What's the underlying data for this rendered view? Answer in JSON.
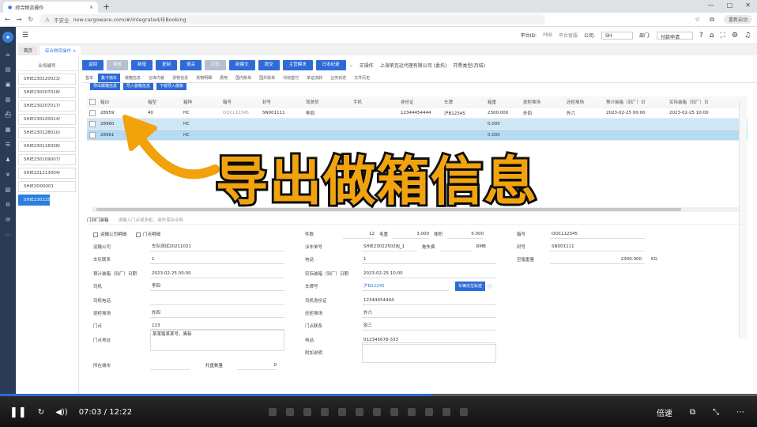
{
  "browser": {
    "tab_title": "综合物流操作",
    "not_secure": "不安全",
    "url": "new.cargoware.com/#/Integrated/IEBooking",
    "restart": "重新启动"
  },
  "topbar": {
    "platform_label": "平台ID:",
    "platform_value": "PBB",
    "platform_name": "平台客服",
    "company_label": "公司:",
    "company_value": "SH",
    "dept_label": "部门:",
    "dept_value": "付款申请"
  },
  "page_tabs": [
    {
      "label": "首页"
    },
    {
      "label": "综合物流操作 ×"
    }
  ],
  "booking_list": {
    "header": "业务编号",
    "items": [
      "SHIE230220023/",
      "SHIE230207018/",
      "SHIE230207017/",
      "SHIE230220014/",
      "SHIE230128010/",
      "SHIE230116008/",
      "SHIE230109007/",
      "SHIE221213004/",
      "SHIE2D00001",
      "SHIE230225028/"
    ],
    "selected_index": 9
  },
  "toolbar": {
    "buttons": [
      "返回",
      "审核",
      "新增",
      "复制",
      "退关",
      "打印",
      "新建文",
      "提交",
      "主营模块",
      "日本纪录"
    ],
    "status_text": "正操作",
    "company_text": "上海荣克运代理有限公司 (委托)",
    "type_text": "开票类型(月结)"
  },
  "subtabs": [
    "基本",
    "集卡拖车",
    "装箱信息",
    "仓库内装",
    "货物信息",
    "货物明细",
    "费用",
    "国内账单",
    "国外账单",
    "代收垫付",
    "单证流转",
    "业务状态",
    "文件历史"
  ],
  "action_buttons": [
    "导出做箱信息",
    "导入装箱信息",
    "下载导入模板"
  ],
  "grid": {
    "columns": [
      "箱ID",
      "箱型",
      "箱种",
      "箱号",
      "封号",
      "驾驶员",
      "手机",
      "身份证",
      "车牌",
      "箱重",
      "提柜堆场",
      "还柜堆场",
      "预计装箱（到厂）日",
      "实际装箱（到厂）日"
    ],
    "rows": [
      [
        "28959",
        "40",
        "HC",
        "OOCL12345",
        "SN001111",
        "李四",
        "",
        "12344454444",
        "沪B12345",
        "2300.000",
        "外四",
        "外六",
        "2023-02-25 00:00",
        "2023-02-25 10:00"
      ],
      [
        "28960",
        "",
        "HC",
        "",
        "",
        "",
        "",
        "",
        "",
        "0.000",
        "",
        "",
        "",
        ""
      ],
      [
        "28961",
        "",
        "HC",
        "",
        "",
        "",
        "",
        "",
        "",
        "0.000",
        "",
        "",
        "",
        ""
      ]
    ]
  },
  "panel": {
    "title": "门到门装箱",
    "hint": "请输入门点或多柜，请先保存业务",
    "checks": [
      "运输公司明细",
      "门点明细"
    ]
  },
  "form": {
    "transport_company_label": "运输公司",
    "transport_company": "车队测试20211021",
    "fleet_contact_label": "车队联系",
    "fleet_contact": "1",
    "est_label": "预计装箱（到厂）日期",
    "est": "2023-02-25 00:00",
    "driver_label": "司机",
    "driver": "李四",
    "driver_phone_label": "司机电话",
    "pickup_yard_label": "提柜堆场",
    "pickup_yard": "外四",
    "door_label": "门点",
    "door": "123",
    "door_addr_label": "门点地址",
    "door_addr": "某某路某某号，奥新",
    "city_label": "所在城市",
    "pallets_label": "托盘数量",
    "pallets": "0",
    "pieces_label": "件数",
    "pieces": "12",
    "gross_label": "毛重",
    "gross": "3.000",
    "volume_label": "体积",
    "volume": "5.000",
    "dispatch_label": "派车单号",
    "dispatch": "SHIE230225028J_1",
    "freight_label": "拖车费",
    "freight_unit": "RMB",
    "phone_label": "电话",
    "phone": "1",
    "actual_label": "实际装箱（到厂）日期",
    "actual": "2023-02-25 10:00",
    "plate_label": "车牌号",
    "plate": "沪B12345",
    "geo_button": "车辆定位轨迹",
    "id_label": "司机身份证",
    "id": "12344454444",
    "return_yard_label": "还柜堆场",
    "return_yard": "外六",
    "contact_label": "门点联系",
    "contact": "张三",
    "tel_label": "电话",
    "tel": "012345678-333",
    "remark_label": "附加说明",
    "box_no_label": "箱号",
    "box_no": "OOCL12345",
    "seal_label": "封号",
    "seal": "SN001111",
    "tare_label": "空箱重量",
    "tare": "2300.000",
    "tare_unit": "KG"
  },
  "overlay": {
    "caption": "导出做箱信息"
  },
  "player": {
    "time": "07:03 / 12:22",
    "speed": "倍速",
    "progress": 0.569
  }
}
